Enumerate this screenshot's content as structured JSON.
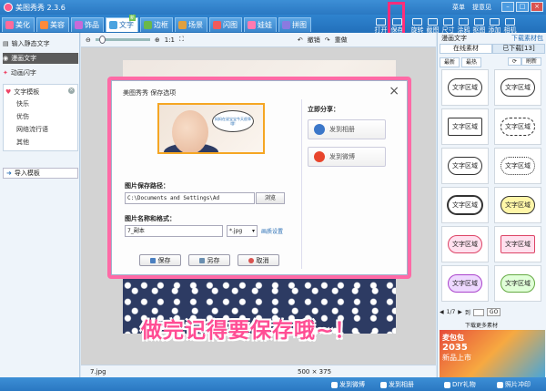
{
  "app": {
    "title": "美图秀秀 2.3.6",
    "links": [
      "菜单",
      "提意见"
    ]
  },
  "tabs": [
    {
      "label": "美化",
      "color": "#ff6a9a"
    },
    {
      "label": "美容",
      "color": "#ff8a3a"
    },
    {
      "label": "饰品",
      "color": "#c86ad8"
    },
    {
      "label": "文字",
      "color": "#4aa3e0",
      "badge": "新",
      "active": true
    },
    {
      "label": "边框",
      "color": "#6ab84a"
    },
    {
      "label": "场景",
      "color": "#e0a040"
    },
    {
      "label": "闪图",
      "color": "#f05a5a"
    },
    {
      "label": "娃娃",
      "color": "#ff7ab0"
    },
    {
      "label": "拼图",
      "color": "#8a7ae0"
    }
  ],
  "toolbar_right": [
    "打开",
    "保存",
    "旋转",
    "截图",
    "尺寸",
    "涂鸦",
    "抠图",
    "添加",
    "相机"
  ],
  "sidebar": {
    "items": [
      {
        "label": "输入静态文字"
      },
      {
        "label": "漫画文字",
        "active": true
      },
      {
        "label": "动画闪字"
      }
    ],
    "template_title": "文字模板",
    "template_items": [
      "快乐",
      "优伤",
      "网络流行语",
      "其他"
    ],
    "import_label": "导入模板"
  },
  "canvas": {
    "zoom_label": "1:1",
    "rotate_left": "撤销",
    "rotate_right": "重做",
    "footer_file": "7.jpg",
    "footer_size": "500 × 375"
  },
  "caption": "做完记得要保存哦~！",
  "dialog": {
    "title": "美图秀秀 保存选项",
    "preview_bubble": "妈妈在说宝宝今天很乖哦!",
    "path_label": "图片保存路径：",
    "path_value": "C:\\Documents and Settings\\Ad",
    "browse_label": "浏览",
    "name_label": "图片名称和格式：",
    "name_value": "7_副本",
    "format_value": "*.jpg",
    "quality_label": "画质设置",
    "buttons": {
      "save": "保存",
      "save_as": "另存",
      "cancel": "取消"
    },
    "share": {
      "title": "立即分享：",
      "album": "发到相册",
      "weibo": "发到微博"
    }
  },
  "rpanel": {
    "title": "漫画文字",
    "download_link": "下载素材包",
    "tabs": [
      "在线素材",
      "已下载[13]"
    ],
    "subtabs": [
      "最新",
      "最热"
    ],
    "refresh": "刷新",
    "sticker_text": "文字区域",
    "pager": "1/7",
    "pager_jump": "到",
    "pager_go": "GO",
    "more_label": "下载更多素材",
    "ad_brand": "麦包包",
    "ad_year": "2035",
    "ad_text": "新品上市"
  },
  "statusbar": {
    "items": [
      "发到微博",
      "发到相册",
      "DIY礼物",
      "照片冲印"
    ]
  }
}
